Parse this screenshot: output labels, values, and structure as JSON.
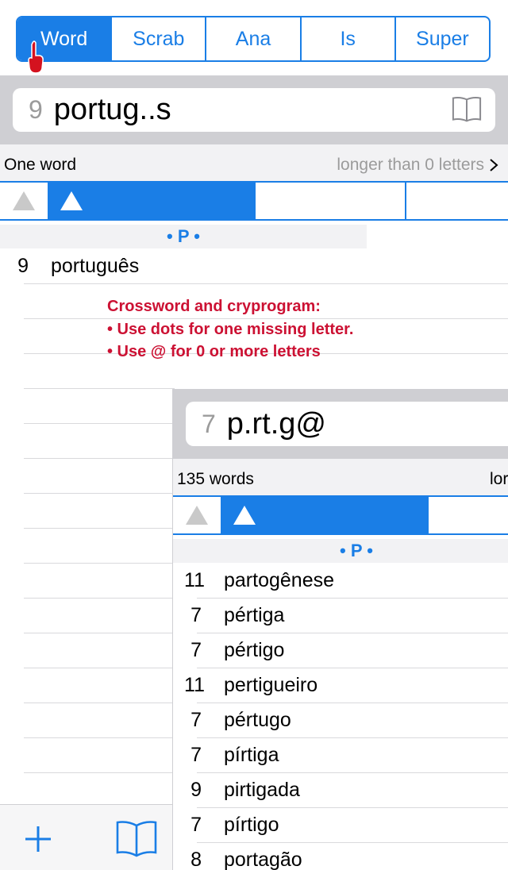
{
  "tabs": [
    "Word",
    "Scrab",
    "Ana",
    "Is",
    "Super"
  ],
  "active_tab": "Word",
  "search": {
    "length": "9",
    "query": "portug..s"
  },
  "info": {
    "left": "One word",
    "right": "longer than 0 letters"
  },
  "section_letter": "• P •",
  "results": [
    {
      "len": "9",
      "word": "português"
    }
  ],
  "note": {
    "line1": "Crossword and cryprogram:",
    "line2": "• Use dots for one missing letter.",
    "line3": "• Use @ for 0 or more letters"
  },
  "panel": {
    "search": {
      "length": "7",
      "query": "p.rt.g@"
    },
    "info_left": "135 words",
    "info_right": "lor",
    "section_letter": "• P •",
    "results": [
      {
        "len": "11",
        "word": "partogênese"
      },
      {
        "len": "7",
        "word": "pértiga"
      },
      {
        "len": "7",
        "word": "pértigo"
      },
      {
        "len": "11",
        "word": "pertigueiro"
      },
      {
        "len": "7",
        "word": "pértugo"
      },
      {
        "len": "7",
        "word": "pírtiga"
      },
      {
        "len": "9",
        "word": "pirtigada"
      },
      {
        "len": "7",
        "word": "pírtigo"
      },
      {
        "len": "8",
        "word": "portagão"
      }
    ]
  },
  "colors": {
    "accent": "#1a7ee6",
    "note": "#cc1133",
    "band": "#cfcfd3"
  },
  "icons": [
    "hand-pointer-icon",
    "book-icon",
    "chevron-right-icon",
    "sort-up-icon",
    "plus-icon"
  ]
}
